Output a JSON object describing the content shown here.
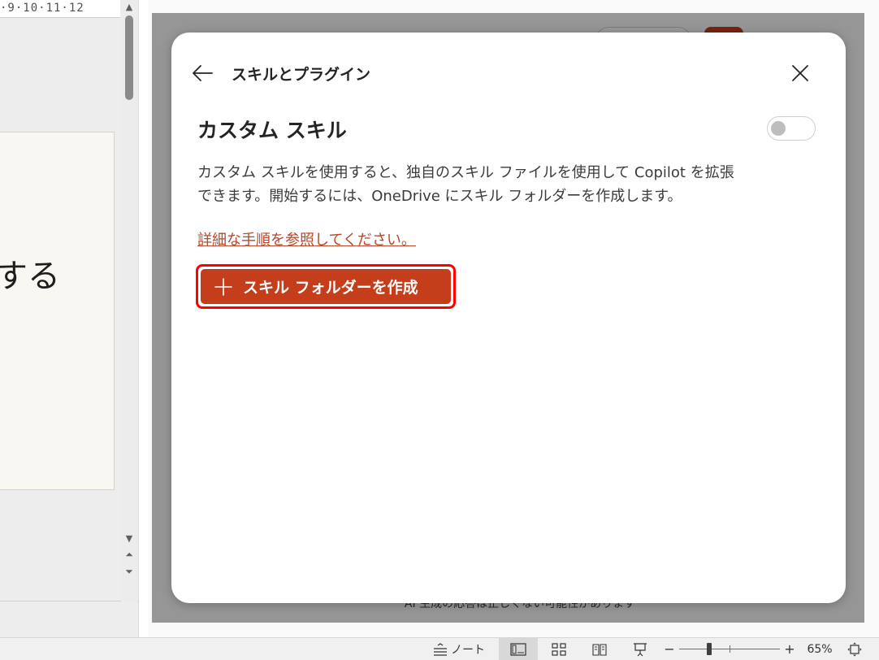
{
  "editor": {
    "ruler_text": "·9·10·11·12",
    "slide_fragment": "する"
  },
  "pane": {
    "footer_text": "AI 生成の応答は正しくない可能性があります"
  },
  "dialog": {
    "title": "スキルとプラグイン",
    "back_icon": "arrow-left-icon",
    "close_icon": "close-icon",
    "section_title": "カスタム スキル",
    "toggle_on": false,
    "description_lines": [
      "カスタム スキルを使用すると、独自のスキル ファイルを使用して Copilot を拡張",
      "できます。開始するには、OneDrive にスキル フォルダーを作成します。"
    ],
    "link_text": "詳細な手順を参照してください。",
    "create_button_label": "スキル フォルダーを作成",
    "create_button_icon": "plus-icon"
  },
  "statusbar": {
    "notes_label": "ノート",
    "zoom_level": "65%",
    "zoom_fraction": 0.3
  },
  "colors": {
    "accent": "#c43e1c",
    "highlight": "#ff0000",
    "link": "#b7472a"
  }
}
